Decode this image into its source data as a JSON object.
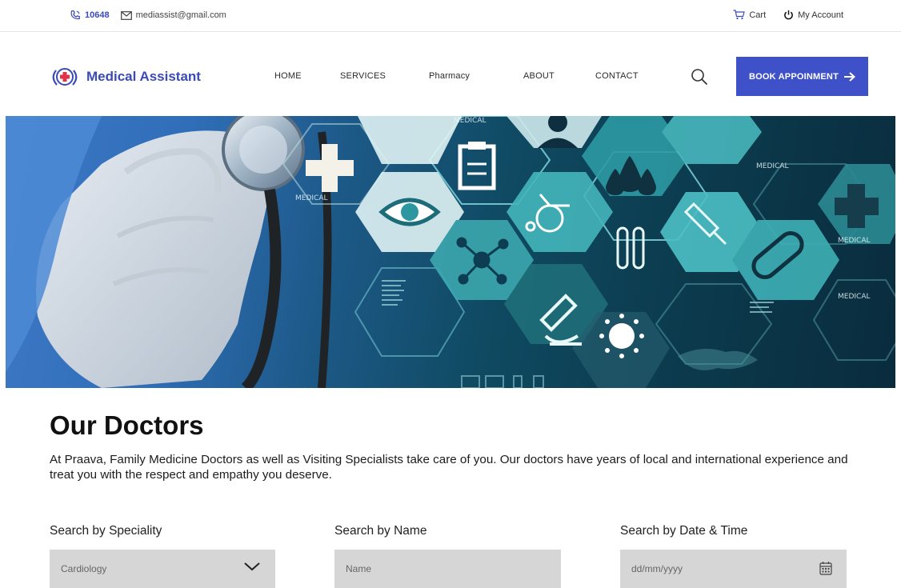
{
  "topbar": {
    "phone": "10648",
    "email": "mediassist@gmail.com",
    "cart_label": "Cart",
    "account_label": "My Account"
  },
  "brand": {
    "name": "Medical Assistant",
    "color": "#3a4bb8"
  },
  "nav": {
    "items": [
      "HOME",
      "SERVICES",
      "Pharmacy",
      "ABOUT",
      "CONTACT"
    ],
    "cta_label": "BOOK APPOINMENT",
    "cta_color": "#3f51c9"
  },
  "hero": {
    "labels": [
      "MEDICAL",
      "MEDICAL",
      "MEDICAL",
      "MEDICAL",
      "MEDICAL"
    ],
    "icons": [
      "cross-icon",
      "clipboard-icon",
      "doctor-icon",
      "drops-icon",
      "eye-icon",
      "wheelchair-icon",
      "molecule-icon",
      "test-tubes-icon",
      "syringe-icon",
      "pill-icon",
      "microscope-icon",
      "virus-icon",
      "cross-icon"
    ]
  },
  "doctors": {
    "title": "Our Doctors",
    "intro": "At Praava, Family Medicine Doctors as well as Visiting Specialists take care of you. Our doctors have years of local and international experience and treat you with the respect and empathy you deserve.",
    "filters": {
      "speciality_label": "Search by Speciality",
      "speciality_value": "Cardiology",
      "name_label": "Search by Name",
      "name_placeholder": "Name",
      "date_label": "Search by Date & Time",
      "date_placeholder": "dd/mm/yyyy"
    }
  }
}
